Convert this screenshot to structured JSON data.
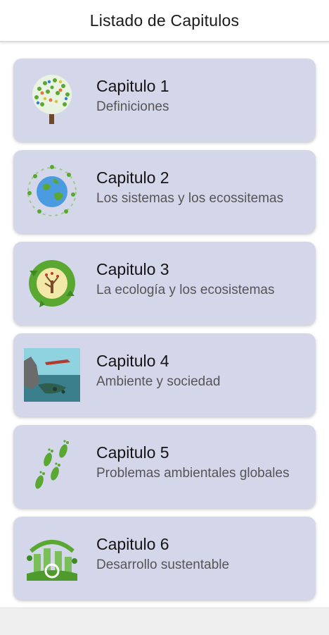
{
  "app": {
    "title": "Listado de Capitulos"
  },
  "chapters": [
    {
      "title": "Capitulo 1",
      "subtitle": "Definiciones",
      "icon": "tree-icon"
    },
    {
      "title": "Capitulo 2",
      "subtitle": "Los sistemas y los ecossitemas",
      "icon": "globe-ecosystem-icon"
    },
    {
      "title": "Capitulo 3",
      "subtitle": "La ecología y los ecosistemas",
      "icon": "recycle-tree-icon"
    },
    {
      "title": "Capitulo 4",
      "subtitle": "Ambiente y sociedad",
      "icon": "polluted-coast-icon"
    },
    {
      "title": "Capitulo 5",
      "subtitle": "Problemas ambientales globales",
      "icon": "green-footprints-icon"
    },
    {
      "title": "Capitulo 6",
      "subtitle": "Desarrollo sustentable",
      "icon": "sustainable-city-icon"
    }
  ],
  "colors": {
    "card_background": "#d4d6ea",
    "app_bar": "#ffffff",
    "accent_green": "#5aa832"
  }
}
